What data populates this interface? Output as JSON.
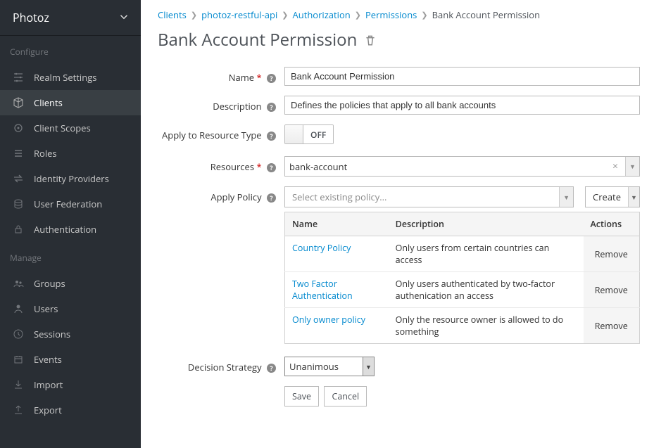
{
  "realm": {
    "name": "Photoz"
  },
  "sidebar": {
    "sections": {
      "configure": {
        "label": "Configure"
      },
      "manage": {
        "label": "Manage"
      }
    },
    "items": {
      "realm_settings": "Realm Settings",
      "clients": "Clients",
      "client_scopes": "Client Scopes",
      "roles": "Roles",
      "identity_providers": "Identity Providers",
      "user_federation": "User Federation",
      "authentication": "Authentication",
      "groups": "Groups",
      "users": "Users",
      "sessions": "Sessions",
      "events": "Events",
      "import": "Import",
      "export": "Export"
    }
  },
  "breadcrumbs": {
    "clients": "Clients",
    "client": "photoz-restful-api",
    "authorization": "Authorization",
    "permissions": "Permissions",
    "current": "Bank Account Permission"
  },
  "page": {
    "title": "Bank Account Permission"
  },
  "form": {
    "labels": {
      "name": "Name",
      "description": "Description",
      "apply_resource_type": "Apply to Resource Type",
      "resources": "Resources",
      "apply_policy": "Apply Policy",
      "decision_strategy": "Decision Strategy"
    },
    "name": "Bank Account Permission",
    "description": "Defines the policies that apply to all bank accounts",
    "apply_resource_type": "OFF",
    "resources": {
      "value": "bank-account"
    },
    "policy_select_placeholder": "Select existing policy...",
    "create_label": "Create",
    "table": {
      "headers": {
        "name": "Name",
        "description": "Description",
        "actions": "Actions"
      },
      "rows": [
        {
          "name": "Country Policy",
          "description": "Only users from certain countries can access",
          "action": "Remove"
        },
        {
          "name": "Two Factor Authentication",
          "description": "Only users authenticated by two-factor authenication an access",
          "action": "Remove"
        },
        {
          "name": "Only owner policy",
          "description": "Only the resource owner is allowed to do something",
          "action": "Remove"
        }
      ]
    },
    "decision_strategy": "Unanimous",
    "buttons": {
      "save": "Save",
      "cancel": "Cancel"
    }
  }
}
